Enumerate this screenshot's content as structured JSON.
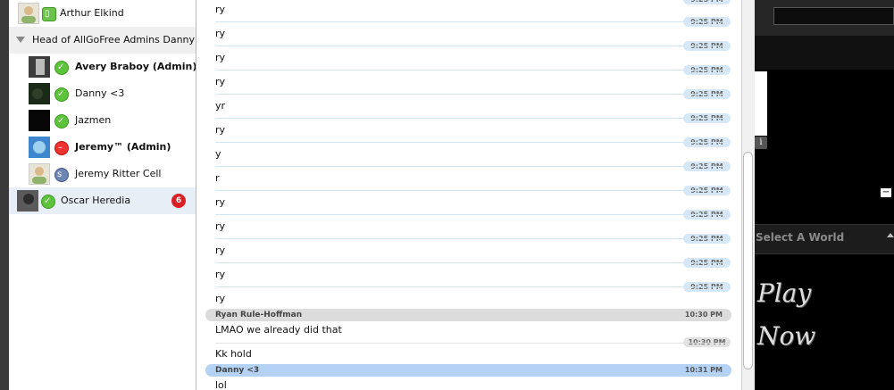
{
  "contacts": {
    "items": [
      {
        "name": "Arthur Elkind",
        "avatar": "person-avatar",
        "status": "mobile-online"
      },
      {
        "name": "Avery Braboy (Admin)",
        "avatar": "photo-avatar",
        "status": "online"
      },
      {
        "name": "Danny <3",
        "avatar": "photo-avatar",
        "status": "online"
      },
      {
        "name": "Jazmen",
        "avatar": "photo-avatar",
        "status": "online"
      },
      {
        "name": "Jeremy™ (Admin)",
        "avatar": "photo-avatar",
        "status": "busy"
      },
      {
        "name": "Jeremy Ritter Cell",
        "avatar": "person-avatar",
        "status": "skype"
      },
      {
        "name": "Oscar Heredia",
        "avatar": "photo-avatar",
        "status": "online",
        "badge": "6"
      }
    ],
    "group_label": "Head of AllGoFree Admins Danny"
  },
  "chat": {
    "messages": [
      {
        "text": "ry",
        "time": "9:25 PM"
      },
      {
        "text": "ry",
        "time": "9:25 PM"
      },
      {
        "text": "ry",
        "time": "9:25 PM"
      },
      {
        "text": "ry",
        "time": "9:25 PM"
      },
      {
        "text": "yr",
        "time": "9:25 PM"
      },
      {
        "text": "ry",
        "time": "9:25 PM"
      },
      {
        "text": "y",
        "time": "9:25 PM"
      },
      {
        "text": "r",
        "time": "9:25 PM"
      },
      {
        "text": "ry",
        "time": "9:25 PM"
      },
      {
        "text": "ry",
        "time": "9:25 PM"
      },
      {
        "text": "ry",
        "time": "9:25 PM"
      },
      {
        "text": "ry",
        "time": "9:25 PM"
      },
      {
        "text": "ry",
        "time": ""
      }
    ],
    "ryan": {
      "sender": "Ryan Rule-Hoffman",
      "time": "10:30 PM",
      "msg1": "LMAO we already did that",
      "msg2_time": "10:30 PM",
      "msg2": "Kk hold"
    },
    "danny": {
      "sender": "Danny <3",
      "time": "10:31 PM",
      "msg1": "lol"
    }
  },
  "game": {
    "world_label": "Select A World",
    "play_line1": "Play",
    "play_line2": "Now",
    "info_glyph": "i",
    "minus_glyph": "−"
  },
  "colors": {
    "timestamp_bg": "#d6e8f7",
    "self_header": "#b4d2f3",
    "other_header": "#dcdcdc",
    "online": "#5cc33a",
    "busy": "#e33333",
    "badge": "#d81f26"
  }
}
